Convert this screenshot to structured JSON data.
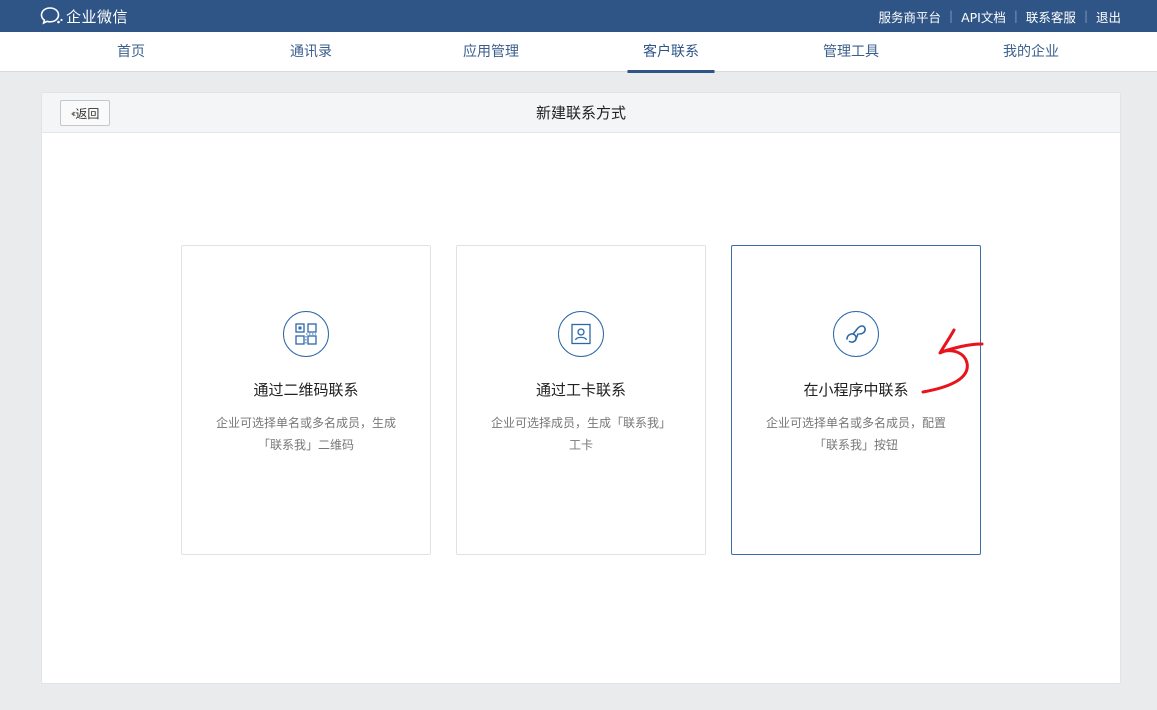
{
  "app": {
    "brand": "企业微信"
  },
  "top_links": [
    {
      "label": "服务商平台"
    },
    {
      "label": "API文档"
    },
    {
      "label": "联系客服"
    },
    {
      "label": "退出"
    }
  ],
  "nav": {
    "tabs": [
      {
        "label": "首页"
      },
      {
        "label": "通讯录"
      },
      {
        "label": "应用管理"
      },
      {
        "label": "客户联系",
        "active": true
      },
      {
        "label": "管理工具"
      },
      {
        "label": "我的企业"
      }
    ]
  },
  "panel": {
    "back_label": "返回",
    "title": "新建联系方式"
  },
  "cards": [
    {
      "icon": "qrcode-icon",
      "title": "通过二维码联系",
      "desc_line1": "企业可选择单名或多名成员，生成",
      "desc_line2": "「联系我」二维码"
    },
    {
      "icon": "badge-card-icon",
      "title": "通过工卡联系",
      "desc_line1": "企业可选择成员，生成「联系我」",
      "desc_line2": "工卡"
    },
    {
      "icon": "mini-program-icon",
      "title": "在小程序中联系",
      "desc_line1": "企业可选择单名或多名成员，配置",
      "desc_line2": "「联系我」按钮",
      "selected": true
    }
  ],
  "colors": {
    "topbar": "#2f5586",
    "accent": "#2d68a8",
    "annotation": "#e8141b"
  }
}
